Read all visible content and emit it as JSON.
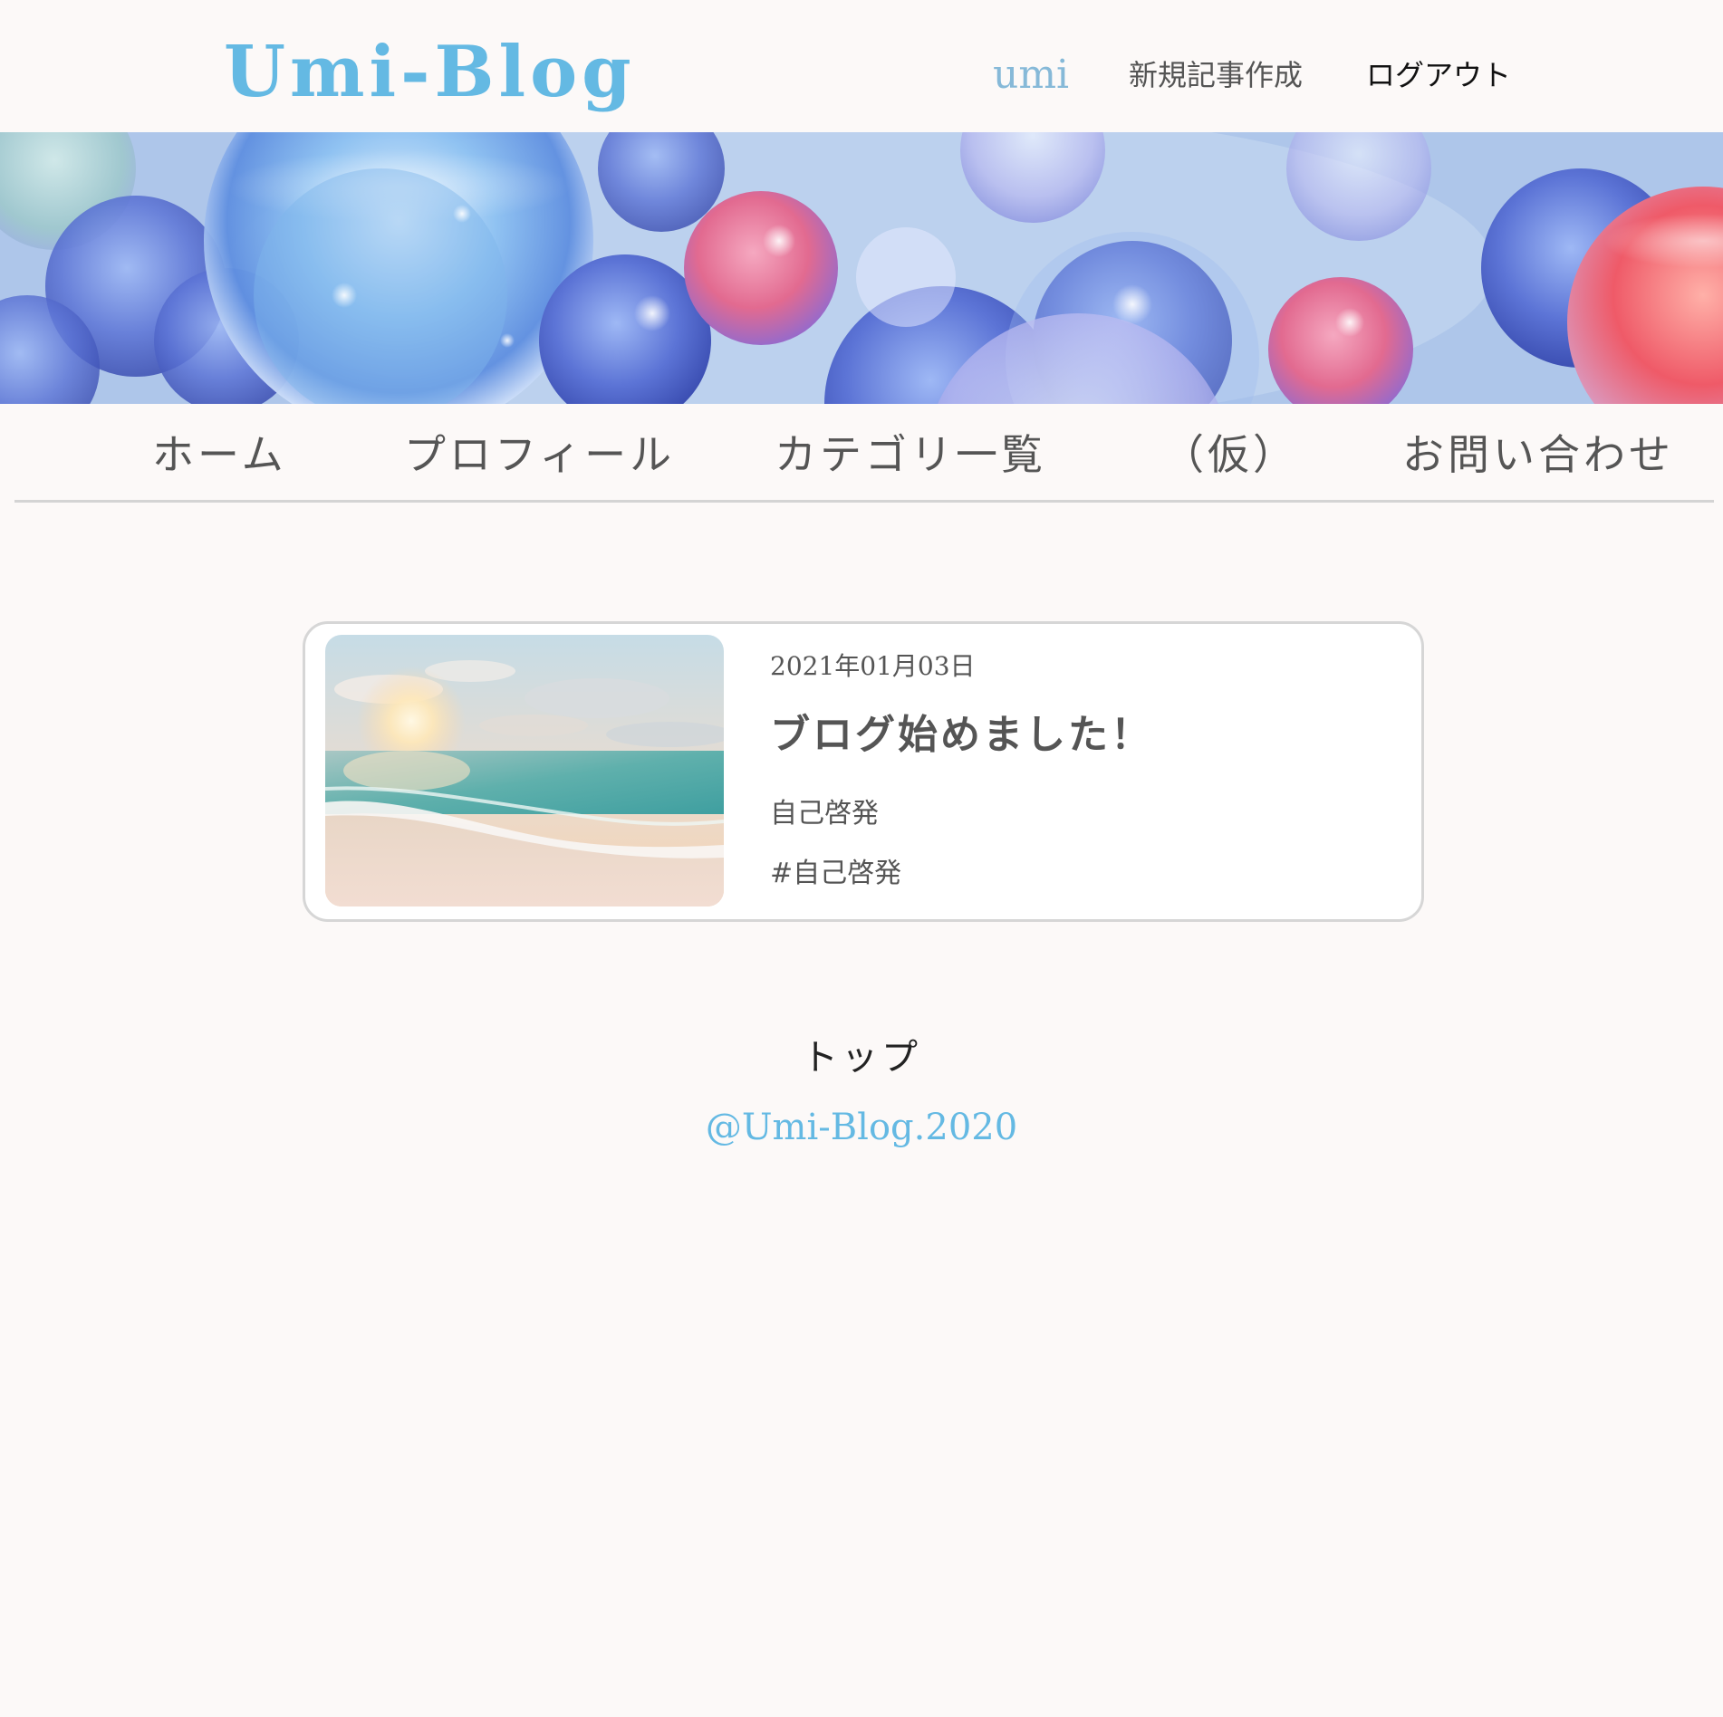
{
  "header": {
    "logo": "Umi-Blog",
    "user_name": "umi",
    "new_post": "新規記事作成",
    "logout": "ログアウト"
  },
  "nav": {
    "items": [
      "ホーム",
      "プロフィール",
      "カテゴリ一覧",
      "（仮）",
      "お問い合わせ"
    ]
  },
  "posts": [
    {
      "date": "2021年01月03日",
      "title": "ブログ始めました！",
      "category": "自己啓発",
      "tag": "#自己啓発"
    }
  ],
  "footer": {
    "top_link": "トップ",
    "copyright": "@Umi-Blog.2020"
  },
  "colors": {
    "brand": "#64b9e3",
    "username": "#86b9d8",
    "text": "#555555",
    "background": "#fcf9f8",
    "card_border": "#d6d6d6"
  }
}
